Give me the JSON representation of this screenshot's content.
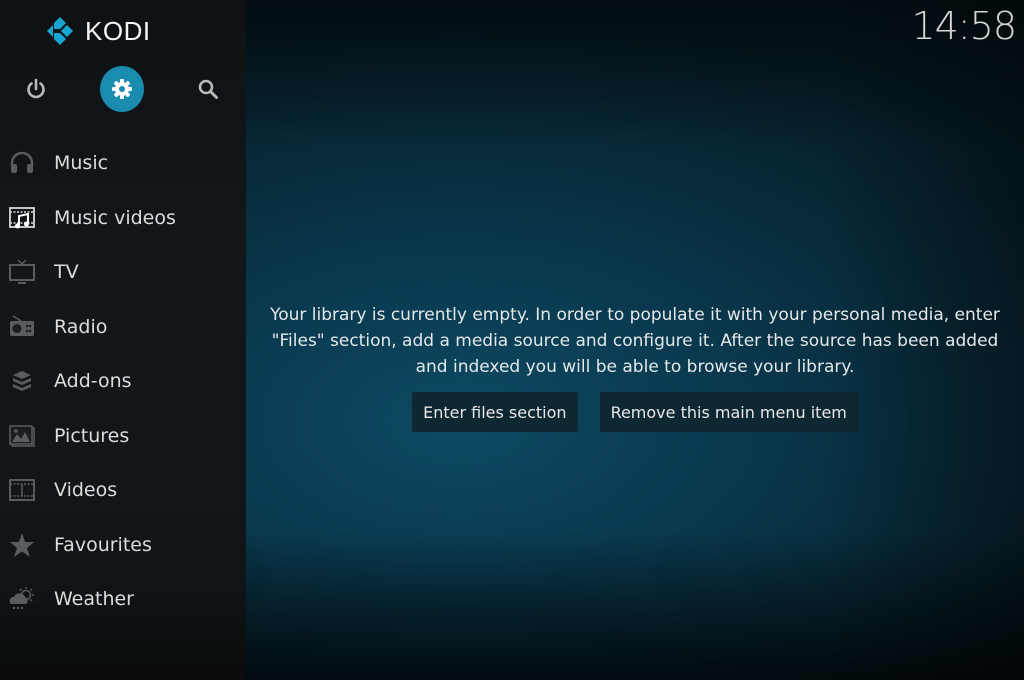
{
  "app": {
    "logo_text": "KODI",
    "accent_color": "#1a8cb0",
    "logo_color": "#17a6d4"
  },
  "clock": "14:58",
  "top_icons": [
    {
      "name": "power-icon",
      "label": "Power"
    },
    {
      "name": "settings-icon",
      "label": "Settings",
      "active": true
    },
    {
      "name": "search-icon",
      "label": "Search"
    }
  ],
  "sidebar": {
    "items": [
      {
        "label": "Music",
        "icon": "headphones-icon"
      },
      {
        "label": "Music videos",
        "icon": "music-video-icon",
        "focused": true
      },
      {
        "label": "TV",
        "icon": "tv-icon"
      },
      {
        "label": "Radio",
        "icon": "radio-icon"
      },
      {
        "label": "Add-ons",
        "icon": "addons-box-icon"
      },
      {
        "label": "Pictures",
        "icon": "pictures-icon"
      },
      {
        "label": "Videos",
        "icon": "film-icon"
      },
      {
        "label": "Favourites",
        "icon": "star-icon"
      },
      {
        "label": "Weather",
        "icon": "weather-icon"
      }
    ]
  },
  "content": {
    "message": "Your library is currently empty. In order to populate it with your personal media, enter \"Files\" section, add a media source and configure it. After the source has been added and indexed you will be able to browse your library.",
    "buttons": {
      "enter_files": "Enter files section",
      "remove_item": "Remove this main menu item"
    }
  }
}
